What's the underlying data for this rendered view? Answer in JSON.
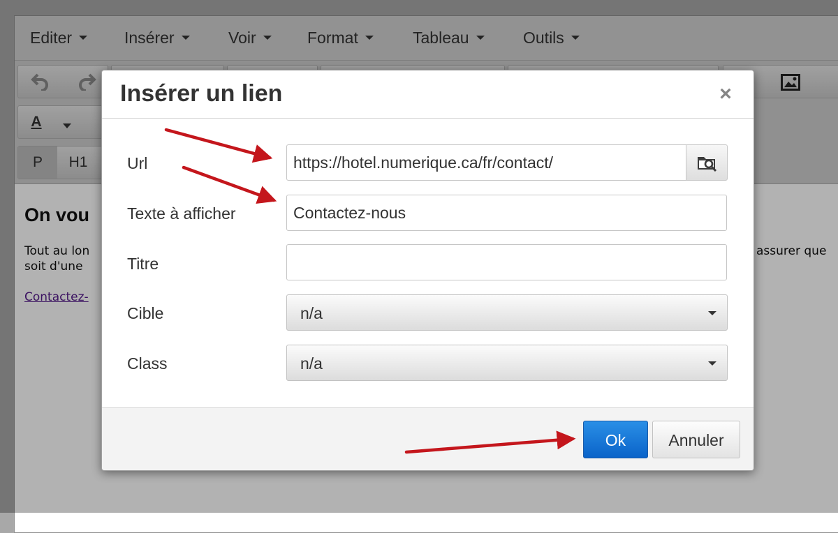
{
  "colors": {
    "primary_button": "#0a63c9",
    "annotation_arrow": "#c4161c",
    "overlay": "#a8a8a8"
  },
  "menubar": {
    "items": [
      {
        "label": "Editer"
      },
      {
        "label": "Insérer"
      },
      {
        "label": "Voir"
      },
      {
        "label": "Format"
      },
      {
        "label": "Tableau"
      },
      {
        "label": "Outils"
      }
    ]
  },
  "toolbar": {
    "undo_icon": "undo-icon",
    "redo_icon": "redo-icon",
    "text_color_label": "A",
    "block_formats": [
      "P",
      "H1"
    ],
    "image_icon": "image-icon"
  },
  "content": {
    "heading": "On vou",
    "line1_start": "Tout au lon",
    "line1_end": "assurer que",
    "line2_start": "soit d'une",
    "link_text": "Contactez-"
  },
  "dialog": {
    "title": "Insérer un lien",
    "close_icon": "close-icon",
    "fields": {
      "url": {
        "label": "Url",
        "value": "https://hotel.numerique.ca/fr/contact/",
        "browse_icon": "folder-search-icon"
      },
      "text": {
        "label": "Texte à afficher",
        "value": "Contactez-nous"
      },
      "title": {
        "label": "Titre",
        "value": ""
      },
      "target": {
        "label": "Cible",
        "value": "n/a"
      },
      "class": {
        "label": "Class",
        "value": "n/a"
      }
    },
    "buttons": {
      "ok": "Ok",
      "cancel": "Annuler"
    }
  }
}
